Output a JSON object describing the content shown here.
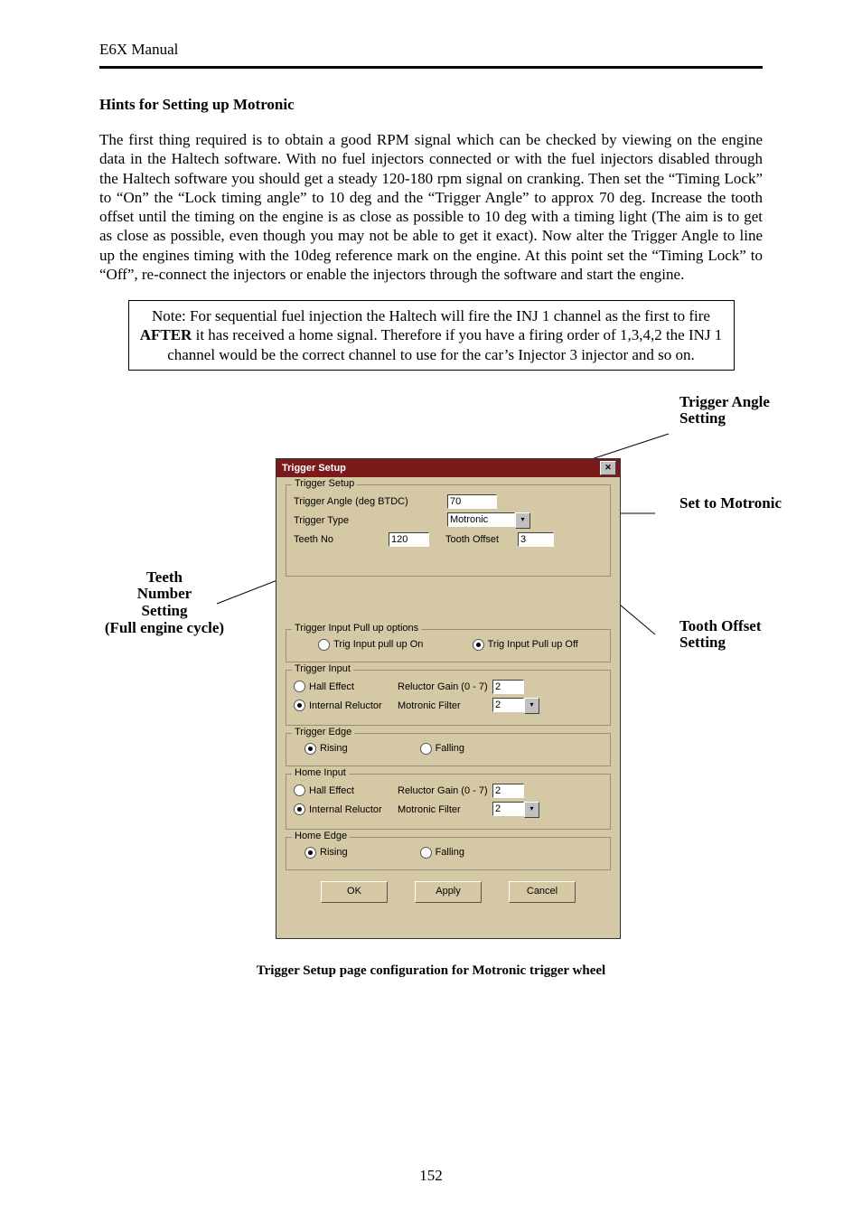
{
  "doc": {
    "header": "E6X Manual",
    "section_title": "Hints for Setting up Motronic",
    "body": "The first thing required is to obtain a good RPM signal which can be checked by viewing on the engine data in the Haltech software. With no fuel injectors connected or with the fuel injectors disabled through the Haltech software you should get a steady 120-180 rpm signal on cranking. Then set the “Timing Lock” to “On” the “Lock timing angle” to 10 deg and the “Trigger Angle” to approx 70 deg. Increase the tooth offset until the timing on the engine is as close as possible to 10 deg with a timing light (The aim is to get as close as possible, even though you may not be able to get it exact). Now alter the Trigger Angle to line up the engines timing with the 10deg reference mark on the engine. At this point set the “Timing Lock” to “Off”, re-connect the injectors or enable the injectors through the software and start the engine.",
    "note_prefix": "Note:  For sequential fuel injection the Haltech will fire the INJ 1 channel as the first to fire ",
    "note_bold": "AFTER",
    "note_suffix": " it has received a home signal. Therefore if you have a firing order of 1,3,4,2 the INJ 1 channel would be the correct channel to use for the car’s Injector 3 injector and so on.",
    "caption": "Trigger Setup page configuration for Motronic trigger wheel",
    "pagenum": "152"
  },
  "callouts": {
    "trigger_angle": "Trigger Angle Setting",
    "set_to_motronic": "Set to Motronic",
    "tooth_offset": "Tooth Offset Setting",
    "teeth_number_l1": "Teeth",
    "teeth_number_l2": "Number",
    "teeth_number_l3": "Setting",
    "teeth_number_l4": "(Full engine cycle)"
  },
  "dialog": {
    "title": "Trigger Setup",
    "close_glyph": "✕",
    "trigger_setup": {
      "legend": "Trigger Setup",
      "trigger_angle_label": "Trigger Angle (deg BTDC)",
      "trigger_angle_value": "70",
      "trigger_type_label": "Trigger Type",
      "trigger_type_value": "Motronic",
      "teeth_no_label": "Teeth No",
      "teeth_no_value": "120",
      "tooth_offset_label": "Tooth Offset",
      "tooth_offset_value": "3"
    },
    "pullup": {
      "legend": "Trigger Input Pull up options",
      "on_label": "Trig Input pull up On",
      "off_label": "Trig Input Pull up Off"
    },
    "trigger_input": {
      "legend": "Trigger Input",
      "hall_label": "Hall Effect",
      "reluctor_label": "Internal Reluctor",
      "gain_label": "Reluctor Gain (0 - 7)",
      "gain_value": "2",
      "filter_label": "Motronic Filter",
      "filter_value": "2"
    },
    "trigger_edge": {
      "legend": "Trigger Edge",
      "rising_label": "Rising",
      "falling_label": "Falling"
    },
    "home_input": {
      "legend": "Home Input",
      "hall_label": "Hall Effect",
      "reluctor_label": "Internal Reluctor",
      "gain_label": "Reluctor Gain (0 - 7)",
      "gain_value": "2",
      "filter_label": "Motronic Filter",
      "filter_value": "2"
    },
    "home_edge": {
      "legend": "Home Edge",
      "rising_label": "Rising",
      "falling_label": "Falling"
    },
    "buttons": {
      "ok": "OK",
      "apply": "Apply",
      "cancel": "Cancel"
    },
    "drop_glyph": "▾"
  }
}
